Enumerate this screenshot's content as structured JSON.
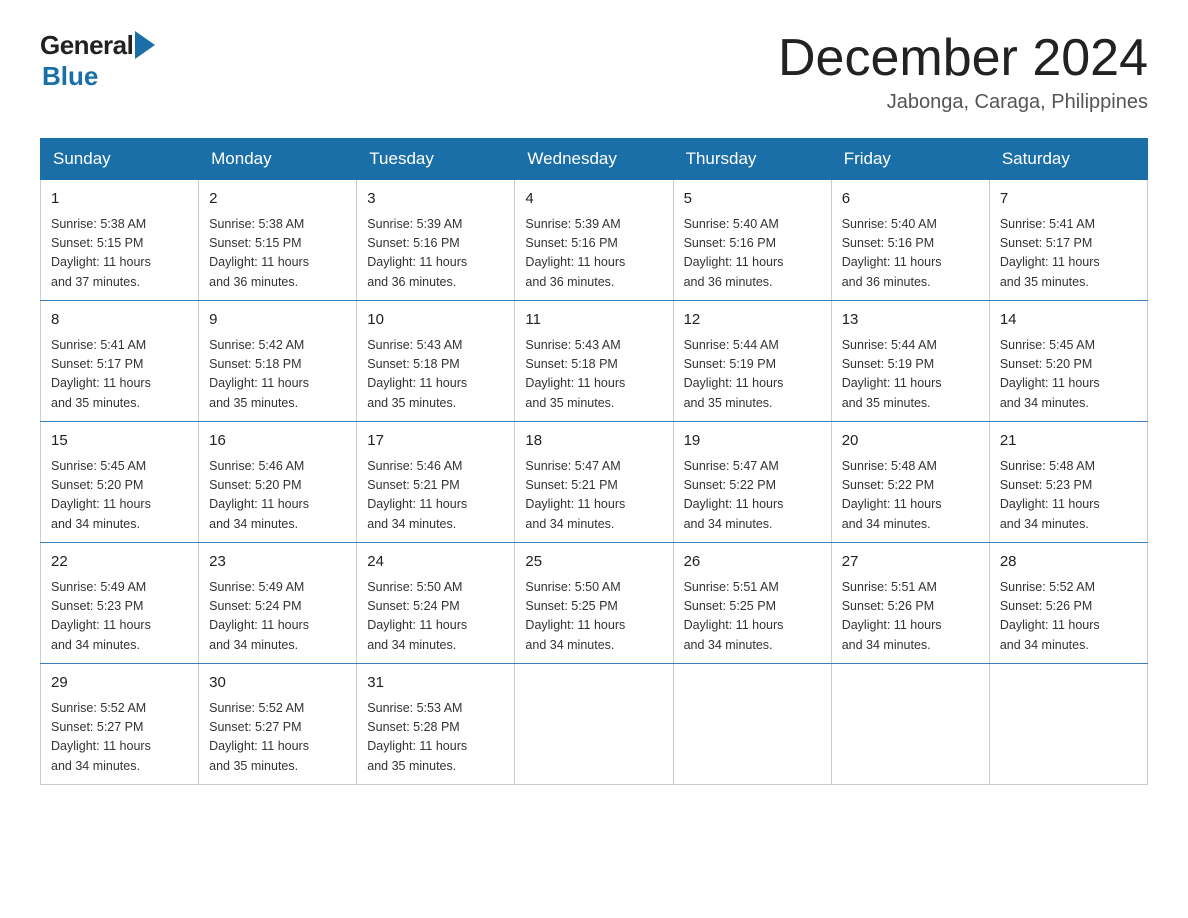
{
  "logo": {
    "general": "General",
    "blue": "Blue"
  },
  "title": "December 2024",
  "location": "Jabonga, Caraga, Philippines",
  "days_of_week": [
    "Sunday",
    "Monday",
    "Tuesday",
    "Wednesday",
    "Thursday",
    "Friday",
    "Saturday"
  ],
  "weeks": [
    [
      {
        "day": "1",
        "sunrise": "5:38 AM",
        "sunset": "5:15 PM",
        "daylight": "11 hours and 37 minutes."
      },
      {
        "day": "2",
        "sunrise": "5:38 AM",
        "sunset": "5:15 PM",
        "daylight": "11 hours and 36 minutes."
      },
      {
        "day": "3",
        "sunrise": "5:39 AM",
        "sunset": "5:16 PM",
        "daylight": "11 hours and 36 minutes."
      },
      {
        "day": "4",
        "sunrise": "5:39 AM",
        "sunset": "5:16 PM",
        "daylight": "11 hours and 36 minutes."
      },
      {
        "day": "5",
        "sunrise": "5:40 AM",
        "sunset": "5:16 PM",
        "daylight": "11 hours and 36 minutes."
      },
      {
        "day": "6",
        "sunrise": "5:40 AM",
        "sunset": "5:16 PM",
        "daylight": "11 hours and 36 minutes."
      },
      {
        "day": "7",
        "sunrise": "5:41 AM",
        "sunset": "5:17 PM",
        "daylight": "11 hours and 35 minutes."
      }
    ],
    [
      {
        "day": "8",
        "sunrise": "5:41 AM",
        "sunset": "5:17 PM",
        "daylight": "11 hours and 35 minutes."
      },
      {
        "day": "9",
        "sunrise": "5:42 AM",
        "sunset": "5:18 PM",
        "daylight": "11 hours and 35 minutes."
      },
      {
        "day": "10",
        "sunrise": "5:43 AM",
        "sunset": "5:18 PM",
        "daylight": "11 hours and 35 minutes."
      },
      {
        "day": "11",
        "sunrise": "5:43 AM",
        "sunset": "5:18 PM",
        "daylight": "11 hours and 35 minutes."
      },
      {
        "day": "12",
        "sunrise": "5:44 AM",
        "sunset": "5:19 PM",
        "daylight": "11 hours and 35 minutes."
      },
      {
        "day": "13",
        "sunrise": "5:44 AM",
        "sunset": "5:19 PM",
        "daylight": "11 hours and 35 minutes."
      },
      {
        "day": "14",
        "sunrise": "5:45 AM",
        "sunset": "5:20 PM",
        "daylight": "11 hours and 34 minutes."
      }
    ],
    [
      {
        "day": "15",
        "sunrise": "5:45 AM",
        "sunset": "5:20 PM",
        "daylight": "11 hours and 34 minutes."
      },
      {
        "day": "16",
        "sunrise": "5:46 AM",
        "sunset": "5:20 PM",
        "daylight": "11 hours and 34 minutes."
      },
      {
        "day": "17",
        "sunrise": "5:46 AM",
        "sunset": "5:21 PM",
        "daylight": "11 hours and 34 minutes."
      },
      {
        "day": "18",
        "sunrise": "5:47 AM",
        "sunset": "5:21 PM",
        "daylight": "11 hours and 34 minutes."
      },
      {
        "day": "19",
        "sunrise": "5:47 AM",
        "sunset": "5:22 PM",
        "daylight": "11 hours and 34 minutes."
      },
      {
        "day": "20",
        "sunrise": "5:48 AM",
        "sunset": "5:22 PM",
        "daylight": "11 hours and 34 minutes."
      },
      {
        "day": "21",
        "sunrise": "5:48 AM",
        "sunset": "5:23 PM",
        "daylight": "11 hours and 34 minutes."
      }
    ],
    [
      {
        "day": "22",
        "sunrise": "5:49 AM",
        "sunset": "5:23 PM",
        "daylight": "11 hours and 34 minutes."
      },
      {
        "day": "23",
        "sunrise": "5:49 AM",
        "sunset": "5:24 PM",
        "daylight": "11 hours and 34 minutes."
      },
      {
        "day": "24",
        "sunrise": "5:50 AM",
        "sunset": "5:24 PM",
        "daylight": "11 hours and 34 minutes."
      },
      {
        "day": "25",
        "sunrise": "5:50 AM",
        "sunset": "5:25 PM",
        "daylight": "11 hours and 34 minutes."
      },
      {
        "day": "26",
        "sunrise": "5:51 AM",
        "sunset": "5:25 PM",
        "daylight": "11 hours and 34 minutes."
      },
      {
        "day": "27",
        "sunrise": "5:51 AM",
        "sunset": "5:26 PM",
        "daylight": "11 hours and 34 minutes."
      },
      {
        "day": "28",
        "sunrise": "5:52 AM",
        "sunset": "5:26 PM",
        "daylight": "11 hours and 34 minutes."
      }
    ],
    [
      {
        "day": "29",
        "sunrise": "5:52 AM",
        "sunset": "5:27 PM",
        "daylight": "11 hours and 34 minutes."
      },
      {
        "day": "30",
        "sunrise": "5:52 AM",
        "sunset": "5:27 PM",
        "daylight": "11 hours and 35 minutes."
      },
      {
        "day": "31",
        "sunrise": "5:53 AM",
        "sunset": "5:28 PM",
        "daylight": "11 hours and 35 minutes."
      },
      null,
      null,
      null,
      null
    ]
  ],
  "labels": {
    "sunrise": "Sunrise:",
    "sunset": "Sunset:",
    "daylight": "Daylight:"
  }
}
